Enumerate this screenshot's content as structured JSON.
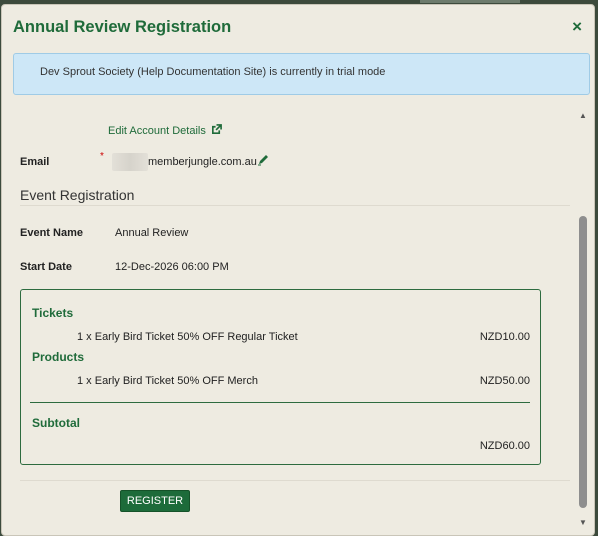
{
  "modal": {
    "title": "Annual Review Registration",
    "close_label": "×"
  },
  "alert": {
    "text": "Dev Sprout Society (Help Documentation Site) is currently in trial mode"
  },
  "account": {
    "edit_link": "Edit Account Details",
    "email_label": "Email",
    "required_marker": "*",
    "email_domain": "memberjungle.com.au"
  },
  "event": {
    "section_title": "Event Registration",
    "name_label": "Event Name",
    "name_value": "Annual Review",
    "start_label": "Start Date",
    "start_value": "12-Dec-2026 06:00 PM"
  },
  "cart": {
    "tickets_heading": "Tickets",
    "tickets": [
      {
        "description": "1 x Early Bird Ticket 50% OFF Regular Ticket",
        "price": "NZD10.00"
      }
    ],
    "products_heading": "Products",
    "products": [
      {
        "description": "1 x Early Bird Ticket 50% OFF Merch",
        "price": "NZD50.00"
      }
    ],
    "subtotal_heading": "Subtotal",
    "subtotal_value": "NZD60.00"
  },
  "actions": {
    "register_label": "REGISTER"
  },
  "icons": {
    "close": "close-icon",
    "external": "external-link-icon",
    "edit": "pencil-icon"
  },
  "colors": {
    "accent": "#1f6b3a",
    "alert_bg": "#cde7f7",
    "modal_bg": "#eeebe1"
  }
}
